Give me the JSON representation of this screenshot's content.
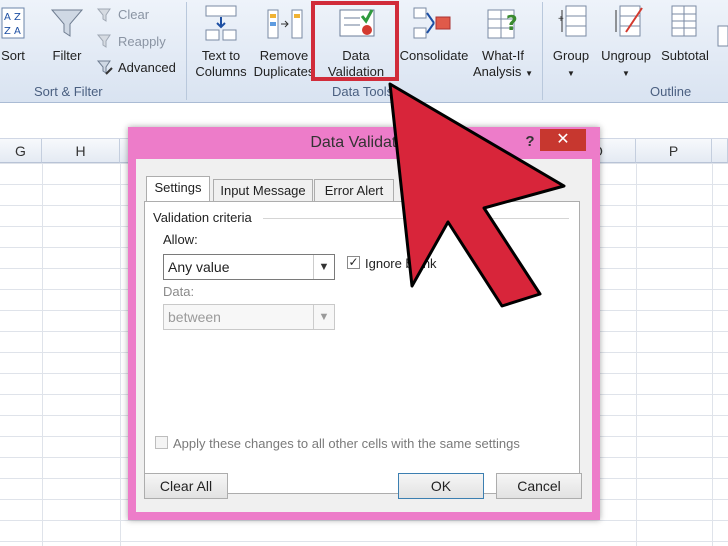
{
  "ribbon": {
    "sort_label": "Sort",
    "filter_label": "Filter",
    "clear_label": "Clear",
    "reapply_label": "Reapply",
    "advanced_label": "Advanced",
    "sort_filter_group": "Sort & Filter",
    "text_to_columns_line1": "Text to",
    "text_to_columns_line2": "Columns",
    "remove_duplicates_line1": "Remove",
    "remove_duplicates_line2": "Duplicates",
    "data_validation_line1": "Data",
    "data_validation_line2": "Validation",
    "consolidate_label": "Consolidate",
    "whatif_line1": "What-If",
    "whatif_line2": "Analysis",
    "data_tools_group": "Data Tools",
    "group_label": "Group",
    "ungroup_label": "Ungroup",
    "subtotal_label": "Subtotal",
    "outline_group": "Outline"
  },
  "columns": {
    "g": "G",
    "h": "H",
    "o": "O",
    "p": "P"
  },
  "dialog": {
    "title": "Data Validation",
    "help": "?",
    "close": "✕",
    "tabs": [
      "Settings",
      "Input Message",
      "Error Alert"
    ],
    "validation_criteria": "Validation criteria",
    "allow_label": "Allow:",
    "allow_value": "Any value",
    "ignore_blank_label": "Ignore blank",
    "ignore_blank_checked": true,
    "data_label": "Data:",
    "data_value": "between",
    "apply_all_label": "Apply these changes to all other cells with the same settings",
    "apply_all_checked": false,
    "clear_all": "Clear All",
    "ok": "OK",
    "cancel": "Cancel"
  },
  "colors": {
    "dialog_frame": "#ed7cc9",
    "arrow_fill": "#d8253a",
    "highlight_border": "#d12c3a"
  }
}
